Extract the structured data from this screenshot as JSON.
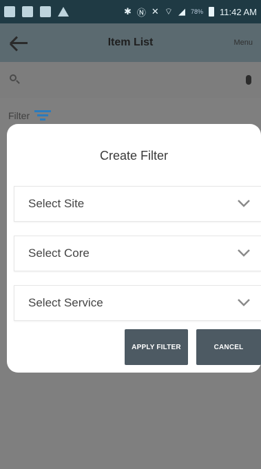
{
  "status_bar": {
    "time": "11:42 AM",
    "battery": "78%"
  },
  "app_bar": {
    "title": "Item List",
    "menu_label": "Menu"
  },
  "filter": {
    "label": "Filter"
  },
  "dialog": {
    "title": "Create Filter",
    "dropdowns": [
      {
        "label": "Select Site"
      },
      {
        "label": "Select Core"
      },
      {
        "label": "Select Service"
      }
    ],
    "apply_label": "APPLY FILTER",
    "cancel_label": "CANCEL"
  },
  "colors": {
    "status_bar": "#1f3a44",
    "app_bar": "#5b6a70",
    "overlay": "#7f7f7f",
    "accent": "#2b7bbd",
    "button": "#4d5a63"
  }
}
